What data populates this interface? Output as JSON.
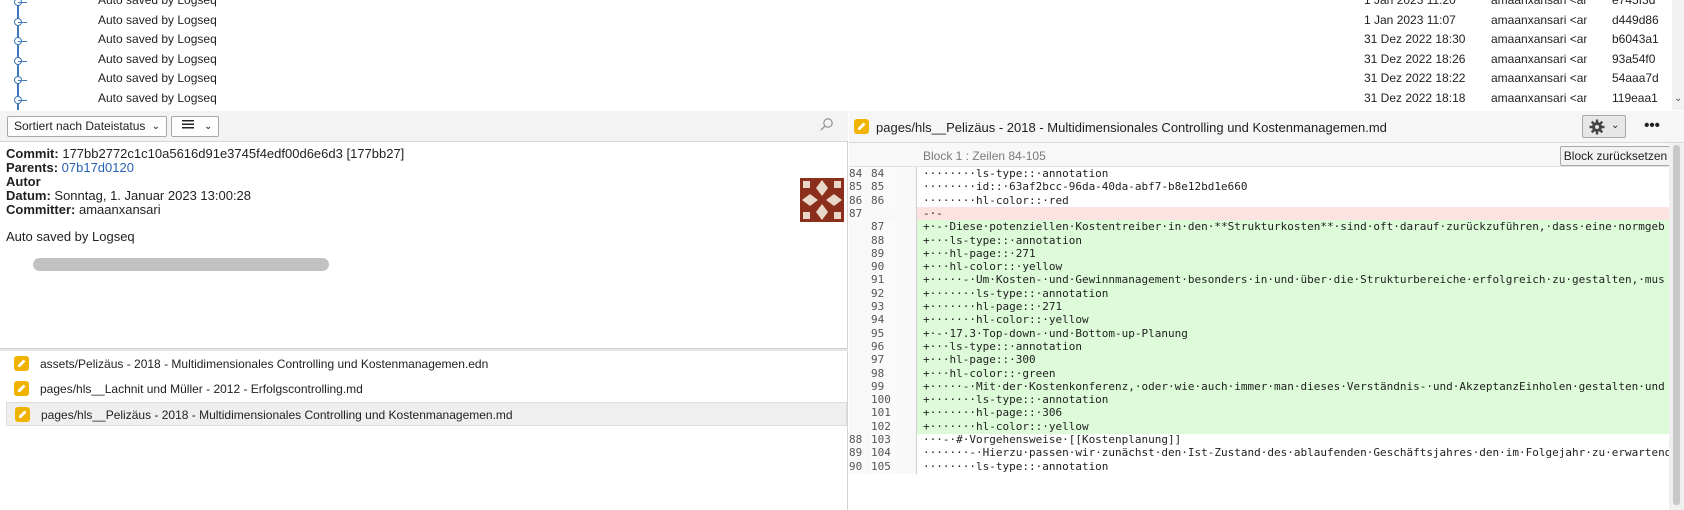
{
  "commits": [
    {
      "message": "Auto saved by Logseq",
      "date": "1 Jan 2023 11:20",
      "author": "amaanxansari <ama",
      "hash": "e745f3d"
    },
    {
      "message": "Auto saved by Logseq",
      "date": "1 Jan 2023 11:07",
      "author": "amaanxansari <ama",
      "hash": "d449d86"
    },
    {
      "message": "Auto saved by Logseq",
      "date": "31 Dez 2022 18:30",
      "author": "amaanxansari <ama",
      "hash": "b6043a1"
    },
    {
      "message": "Auto saved by Logseq",
      "date": "31 Dez 2022 18:26",
      "author": "amaanxansari <ama",
      "hash": "93a54f0"
    },
    {
      "message": "Auto saved by Logseq",
      "date": "31 Dez 2022 18:22",
      "author": "amaanxansari <ama",
      "hash": "54aaa7d"
    },
    {
      "message": "Auto saved by Logseq",
      "date": "31 Dez 2022 18:18",
      "author": "amaanxansari <ama",
      "hash": "119eaa1"
    }
  ],
  "toolbar": {
    "sort_label": "Sortiert nach Dateistatus"
  },
  "details": {
    "commit_label": "Commit:",
    "commit_value": "177bb2772c1c10a5616d91e3745f4edf00d6e6d3 [177bb27]",
    "parents_label": "Parents:",
    "parents_value": "07b17d0120",
    "author_label": "Autor",
    "date_label": "Datum:",
    "date_value": "Sonntag, 1. Januar 2023 13:00:28",
    "committer_label": "Committer:",
    "committer_value": "amaanxansari",
    "message": "Auto saved by Logseq"
  },
  "files": [
    "assets/Pelizäus - 2018 - Multidimensionales Controlling und Kostenmanagemen.edn",
    "pages/hls__Lachnit und Müller - 2012 - Erfolgscontrolling.md",
    "pages/hls__Pelizäus - 2018 - Multidimensionales Controlling und Kostenmanagemen.md"
  ],
  "diff": {
    "file_title": "pages/hls__Pelizäus - 2018 - Multidimensionales Controlling und Kostenmanagemen.md",
    "block_label": "Block 1 : Zeilen  84-105",
    "reset_label": "Block zurücksetzen",
    "more_label": "•••",
    "lines": [
      {
        "old": "84",
        "new": "84",
        "type": "ctx",
        "text": "········ls-type::·annotation"
      },
      {
        "old": "85",
        "new": "85",
        "type": "ctx",
        "text": "········id::·63af2bcc-96da-40da-abf7-b8e12bd1e660"
      },
      {
        "old": "86",
        "new": "86",
        "type": "ctx",
        "text": "········hl-color::·red"
      },
      {
        "old": "87",
        "new": "",
        "type": "del",
        "text": "-·-"
      },
      {
        "old": "",
        "new": "87",
        "type": "add",
        "text": "+·-·Diese·potenziellen·Kostentreiber·in·den·**Strukturkosten**·sind·oft·darauf·zurückzuführen,·dass·eine·normgeb"
      },
      {
        "old": "",
        "new": "88",
        "type": "add",
        "text": "+···ls-type::·annotation"
      },
      {
        "old": "",
        "new": "89",
        "type": "add",
        "text": "+···hl-page::·271"
      },
      {
        "old": "",
        "new": "90",
        "type": "add",
        "text": "+···hl-color::·yellow"
      },
      {
        "old": "",
        "new": "91",
        "type": "add",
        "text": "+·····-·Um·Kosten-·und·Gewinnmanagement·besonders·in·und·über·die·Strukturbereiche·erfolgreich·zu·gestalten,·mus"
      },
      {
        "old": "",
        "new": "92",
        "type": "add",
        "text": "+·······ls-type::·annotation"
      },
      {
        "old": "",
        "new": "93",
        "type": "add",
        "text": "+·······hl-page::·271"
      },
      {
        "old": "",
        "new": "94",
        "type": "add",
        "text": "+·······hl-color::·yellow"
      },
      {
        "old": "",
        "new": "95",
        "type": "add",
        "text": "+·-·17.3·Top-down-·und·Bottom-up-Planung"
      },
      {
        "old": "",
        "new": "96",
        "type": "add",
        "text": "+···ls-type::·annotation"
      },
      {
        "old": "",
        "new": "97",
        "type": "add",
        "text": "+···hl-page::·300"
      },
      {
        "old": "",
        "new": "98",
        "type": "add",
        "text": "+···hl-color::·green"
      },
      {
        "old": "",
        "new": "99",
        "type": "add",
        "text": "+·····-·Mit·der·Kostenkonferenz,·oder·wie·auch·immer·man·dieses·Verständnis-·und·AkzeptanzEinholen·gestalten·und"
      },
      {
        "old": "",
        "new": "100",
        "type": "add",
        "text": "+·······ls-type::·annotation"
      },
      {
        "old": "",
        "new": "101",
        "type": "add",
        "text": "+·······hl-page::·306"
      },
      {
        "old": "",
        "new": "102",
        "type": "add",
        "text": "+·······hl-color::·yellow"
      },
      {
        "old": "88",
        "new": "103",
        "type": "ctx",
        "text": "···-·#·Vorgehensweise·[[Kostenplanung]]"
      },
      {
        "old": "89",
        "new": "104",
        "type": "ctx",
        "text": "·······-·Hierzu·passen·wir·zunächst·den·Ist-Zustand·des·ablaufenden·Geschäftsjahres·den·im·Folgejahr·zu·erwartend"
      },
      {
        "old": "90",
        "new": "105",
        "type": "ctx",
        "text": "········ls-type::·annotation"
      }
    ]
  },
  "colors": {
    "graph": "#3f78b8",
    "added_bg": "#ddfbd9",
    "deleted_bg": "#fde2e2",
    "file_icon": "#f0b400"
  }
}
